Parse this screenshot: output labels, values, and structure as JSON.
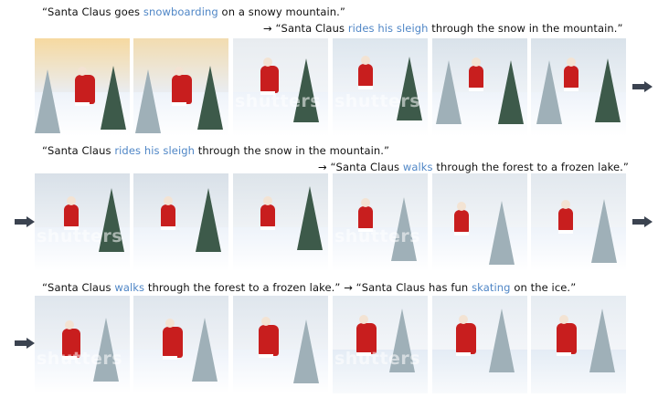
{
  "captions": [
    {
      "pre": "“Santa Claus goes ",
      "hl": "snowboarding",
      "post": " on a snowy mountain.”"
    },
    {
      "pre": "→ “Santa Claus ",
      "hl": "rides his sleigh",
      "post": " through the snow in the mountain.”"
    },
    {
      "pre": "“Santa Claus ",
      "hl": "rides his sleigh",
      "post": " through the snow in the mountain.”"
    },
    {
      "pre": "→ “Santa Claus ",
      "hl": "walks",
      "post": " through the forest to a frozen lake.”"
    },
    {
      "pre": "“Santa Claus ",
      "hl": "walks",
      "post": " through the forest to a frozen lake.” → “Santa Claus has fun ",
      "hl2": "skating",
      "post2": " on the ice.”"
    }
  ],
  "watermark": "shutters",
  "colors": {
    "highlight": "#4f86c6",
    "arrow": "#3b4350"
  },
  "icons": {
    "continue": "arrow-right-icon"
  }
}
